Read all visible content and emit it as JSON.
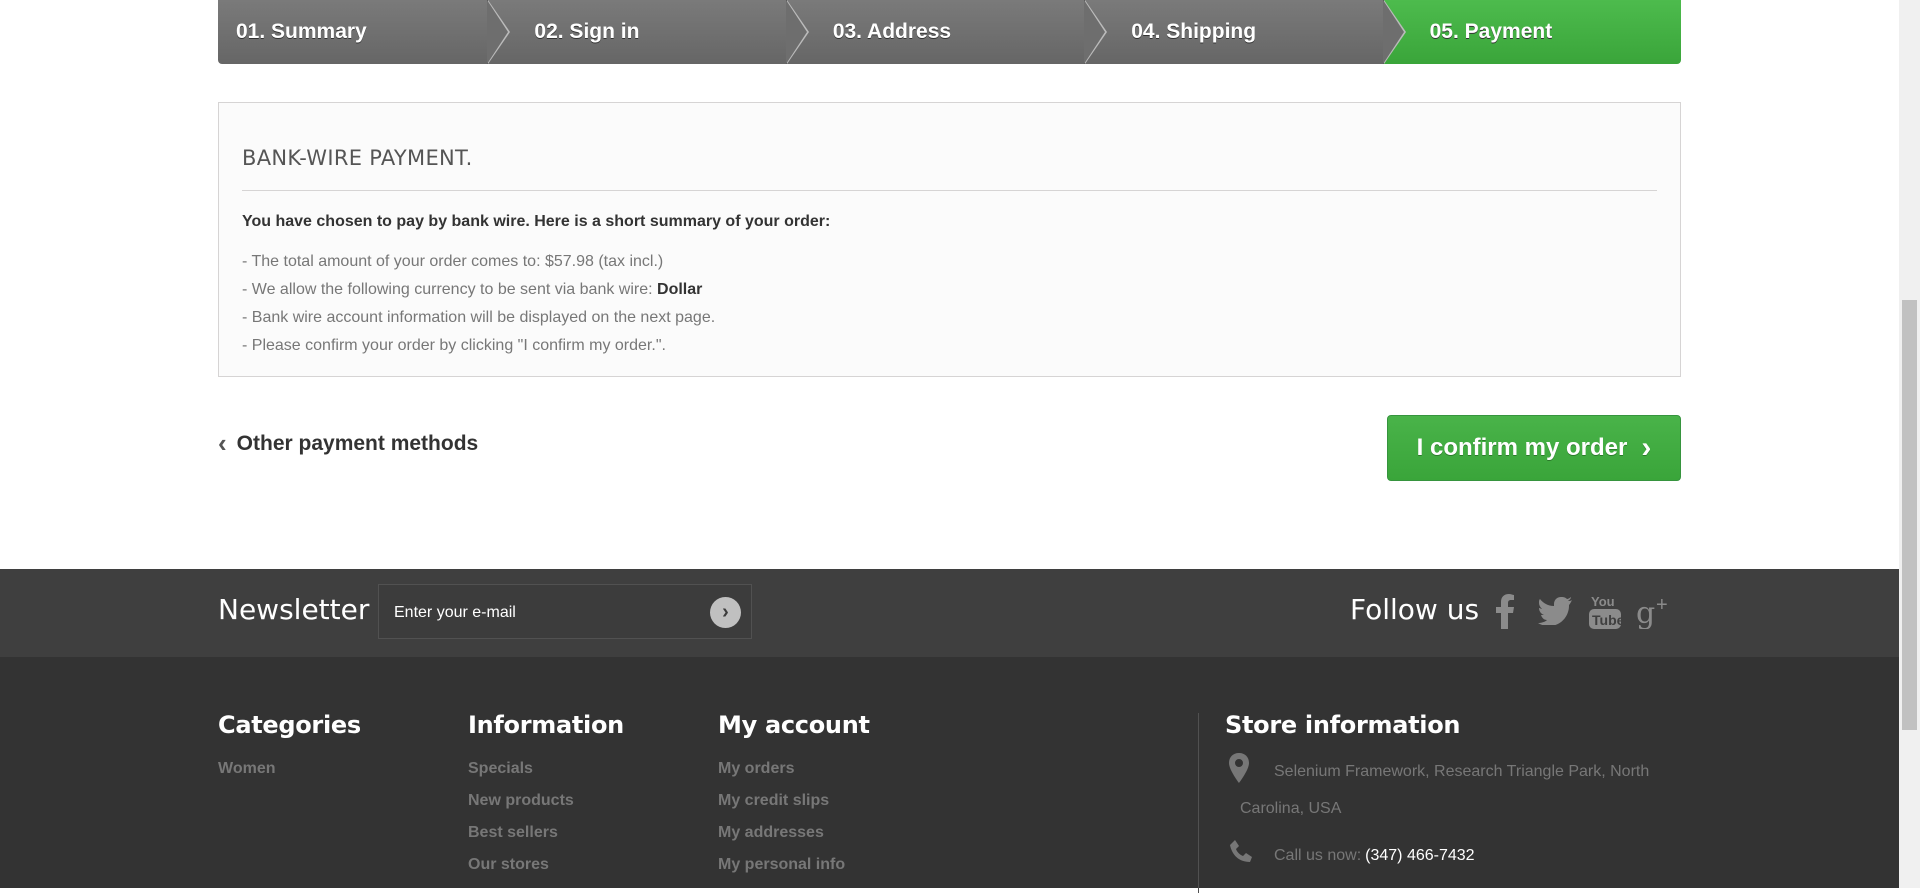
{
  "steps": [
    {
      "label": "01. Summary",
      "active": false
    },
    {
      "label": "02. Sign in",
      "active": false
    },
    {
      "label": "03. Address",
      "active": false
    },
    {
      "label": "04. Shipping",
      "active": false
    },
    {
      "label": "05. Payment",
      "active": true
    }
  ],
  "payment": {
    "title": "BANK-WIRE PAYMENT.",
    "intro": "You have chosen to pay by bank wire. Here is a short summary of your order:",
    "line1": "- The total amount of your order comes to: $57.98 (tax incl.)",
    "line2_prefix": "- We allow the following currency to be sent via bank wire: ",
    "line2_currency": "Dollar",
    "line3": "- Bank wire account information will be displayed on the next page.",
    "line4": "- Please confirm your order by clicking \"I confirm my order.\"."
  },
  "nav": {
    "back_label": "Other payment methods",
    "confirm_label": "I confirm my order"
  },
  "newsletter": {
    "title": "Newsletter",
    "placeholder": "Enter your e-mail"
  },
  "follow": {
    "title": "Follow us",
    "networks": [
      "facebook-icon",
      "twitter-icon",
      "youtube-icon",
      "google-plus-icon"
    ]
  },
  "footer": {
    "categories": {
      "title": "Categories",
      "items": [
        "Women"
      ]
    },
    "information": {
      "title": "Information",
      "items": [
        "Specials",
        "New products",
        "Best sellers",
        "Our stores"
      ]
    },
    "account": {
      "title": "My account",
      "items": [
        "My orders",
        "My credit slips",
        "My addresses",
        "My personal info"
      ]
    },
    "store": {
      "title": "Store information",
      "address": "Selenium Framework, Research Triangle Park, North Carolina, USA",
      "call_label": "Call us now:",
      "phone": "(347) 466-7432"
    }
  },
  "colors": {
    "accent_green": "#3aa53a",
    "step_gray": "#6e6e6e",
    "footer_bg": "#333333",
    "newsletter_bg": "#3f3f3f"
  }
}
